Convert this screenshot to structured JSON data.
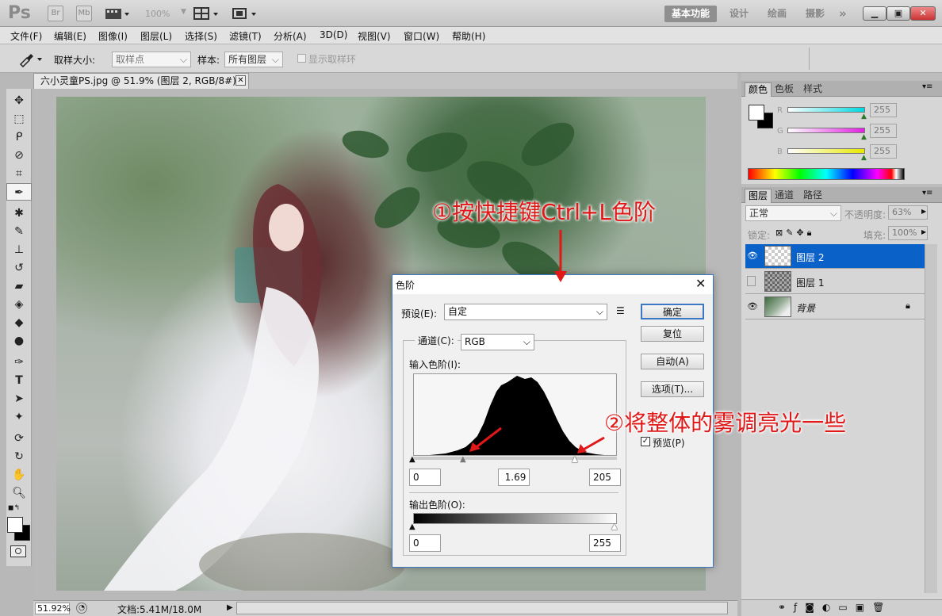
{
  "app": {
    "logo": "Ps",
    "bridge_btn": "Br",
    "minibridge_btn": "Mb",
    "zoom": "100%",
    "workspaces": [
      "基本功能",
      "设计",
      "绘画",
      "摄影"
    ],
    "more": "»",
    "window_controls": [
      "minimize",
      "restore",
      "close"
    ]
  },
  "menu": [
    "文件(F)",
    "编辑(E)",
    "图像(I)",
    "图层(L)",
    "选择(S)",
    "滤镜(T)",
    "分析(A)",
    "3D(D)",
    "视图(V)",
    "窗口(W)",
    "帮助(H)"
  ],
  "options": {
    "sample_size_label": "取样大小:",
    "sample_size_value": "取样点",
    "sample_label": "样本:",
    "sample_value": "所有图层",
    "show_ring_label": "显示取样环"
  },
  "document": {
    "tab_title": "六小灵童PS.jpg @ 51.9% (图层 2, RGB/8#) *",
    "zoom_status": "51.92%",
    "doc_status": "文档:5.41M/18.0M"
  },
  "color_panel": {
    "tabs": [
      "颜色",
      "色板",
      "样式"
    ],
    "channels": [
      {
        "label": "R",
        "value": "255",
        "color": "#00d8e0"
      },
      {
        "label": "G",
        "value": "255",
        "color": "#e020e0"
      },
      {
        "label": "B",
        "value": "255",
        "color": "#e8e800"
      }
    ]
  },
  "layers_panel": {
    "tabs": [
      "图层",
      "通道",
      "路径"
    ],
    "blend_mode": "正常",
    "opacity_label": "不透明度:",
    "opacity_value": "63%",
    "lock_label": "锁定:",
    "fill_label": "填充:",
    "fill_value": "100%",
    "layers": [
      {
        "name": "图层 2",
        "visible": true,
        "selected": true
      },
      {
        "name": "图层 1",
        "visible": false,
        "selected": false
      },
      {
        "name": "背景",
        "visible": true,
        "selected": false,
        "locked": true
      }
    ]
  },
  "levels_dialog": {
    "title": "色阶",
    "preset_label": "预设(E):",
    "preset_value": "自定",
    "channel_label": "通道(C):",
    "channel_value": "RGB",
    "input_label": "输入色阶(I):",
    "input_black": "0",
    "input_gamma": "1.69",
    "input_white": "205",
    "output_label": "输出色阶(O):",
    "output_black": "0",
    "output_white": "255",
    "buttons": {
      "ok": "确定",
      "reset": "复位",
      "auto": "自动(A)",
      "options": "选项(T)..."
    },
    "preview_label": "预览(P)",
    "preview_checked": true
  },
  "annotations": {
    "step1": "①按快捷键Ctrl+L色阶",
    "step2": "②将整体的雾调亮光一些"
  }
}
